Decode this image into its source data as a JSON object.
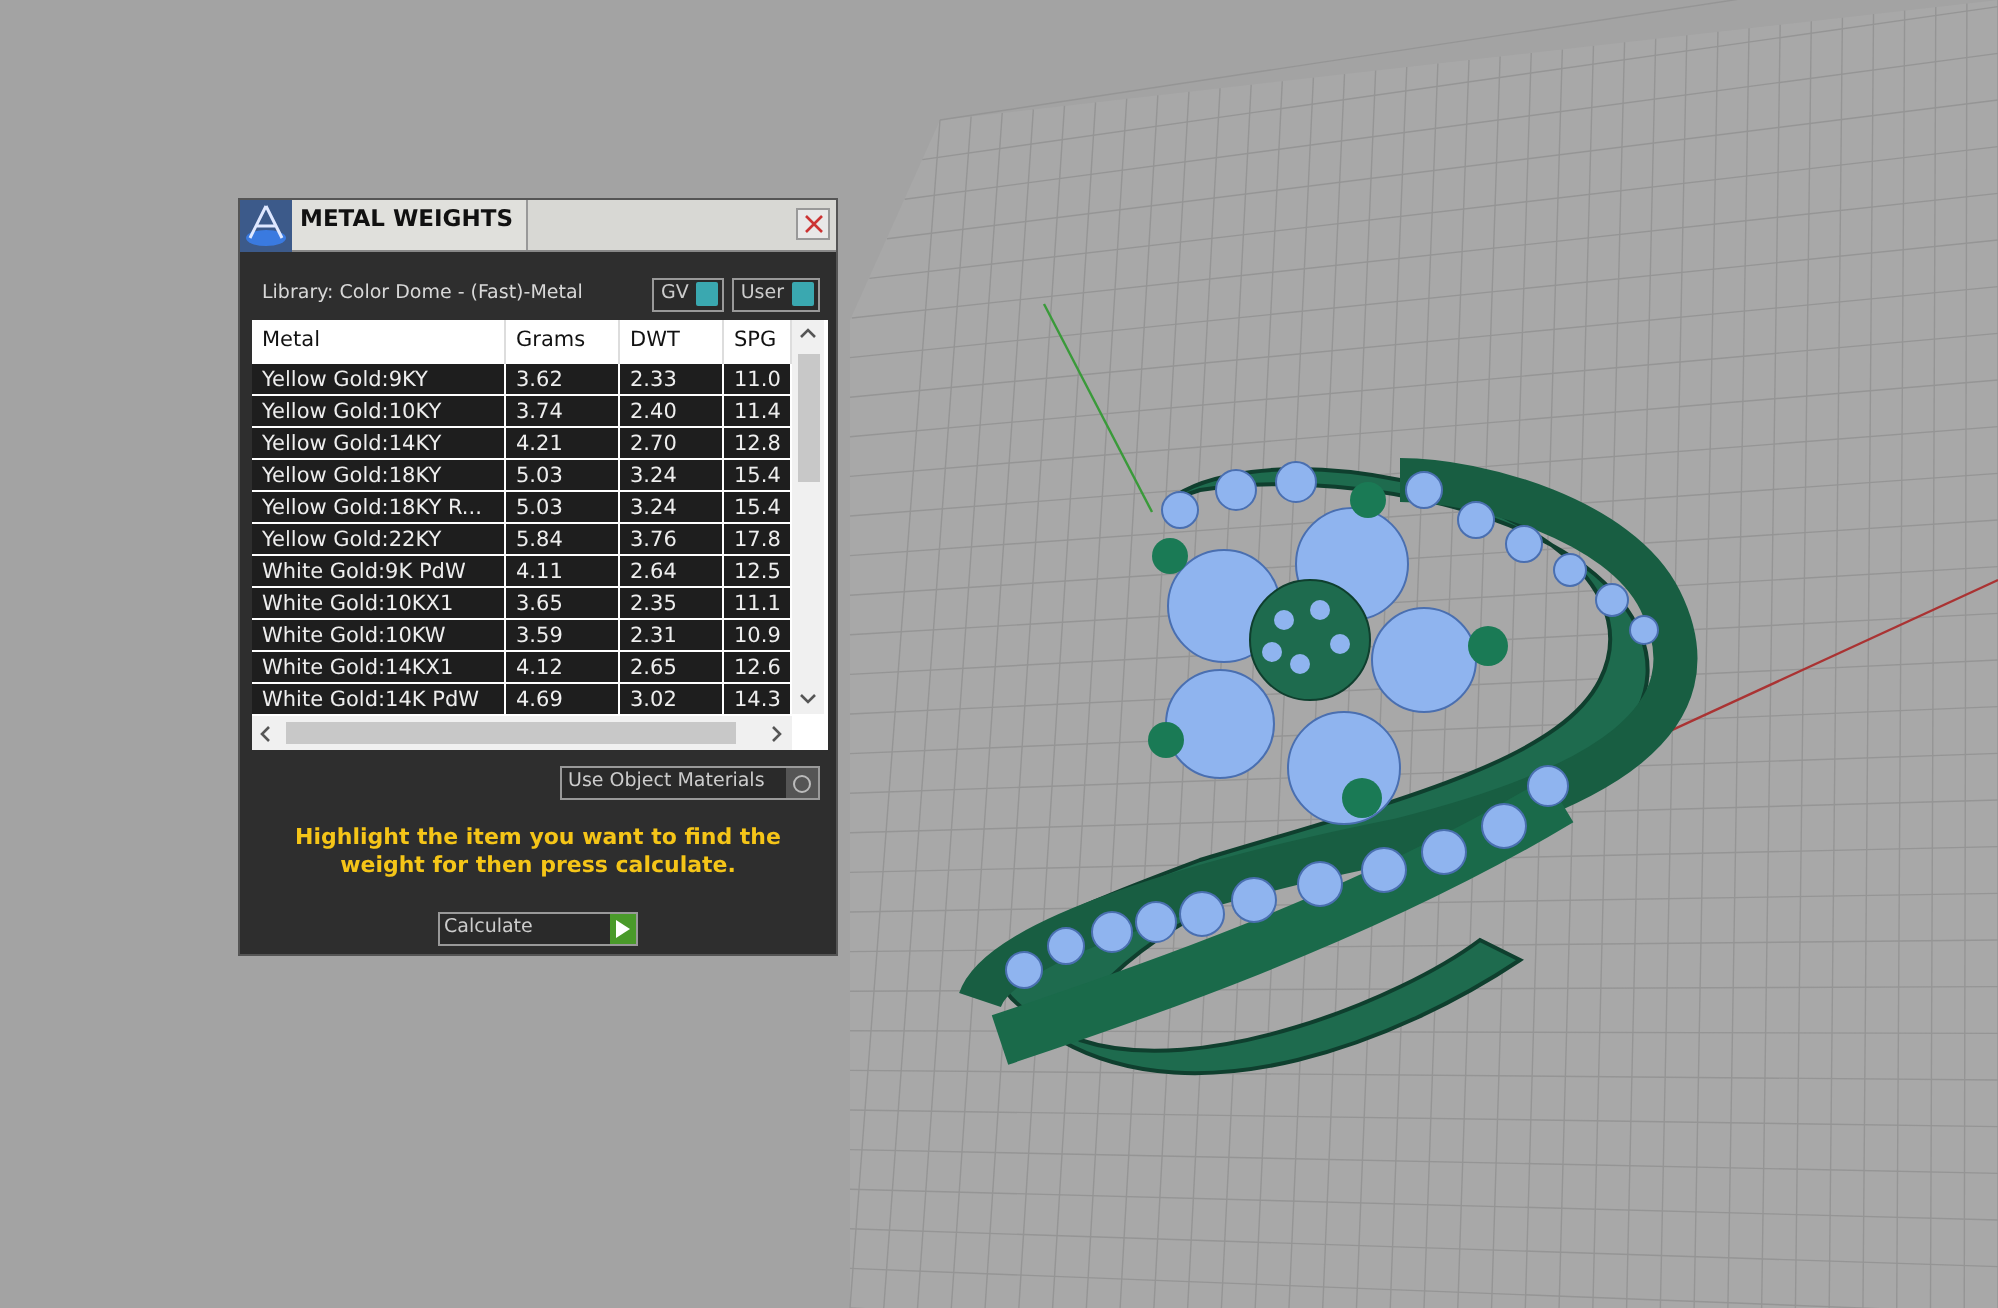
{
  "window": {
    "title": "METAL WEIGHTS"
  },
  "library_label": "Library: Color Dome - (Fast)-Metal",
  "toggles": [
    {
      "label": "GV"
    },
    {
      "label": "User"
    }
  ],
  "table": {
    "columns": [
      "Metal",
      "Grams",
      "DWT",
      "SPG"
    ],
    "rows": [
      [
        "Yellow Gold:9KY",
        "3.62",
        "2.33",
        "11.0"
      ],
      [
        "Yellow Gold:10KY",
        "3.74",
        "2.40",
        "11.4"
      ],
      [
        "Yellow Gold:14KY",
        "4.21",
        "2.70",
        "12.8"
      ],
      [
        "Yellow Gold:18KY",
        "5.03",
        "3.24",
        "15.4"
      ],
      [
        "Yellow Gold:18KY R...",
        "5.03",
        "3.24",
        "15.4"
      ],
      [
        "Yellow Gold:22KY",
        "5.84",
        "3.76",
        "17.8"
      ],
      [
        "White Gold:9K PdW",
        "4.11",
        "2.64",
        "12.5"
      ],
      [
        "White Gold:10KX1",
        "3.65",
        "2.35",
        "11.1"
      ],
      [
        "White Gold:10KW",
        "3.59",
        "2.31",
        "10.9"
      ],
      [
        "White Gold:14KX1",
        "4.12",
        "2.65",
        "12.6"
      ],
      [
        "White Gold:14K PdW",
        "4.69",
        "3.02",
        "14.3"
      ]
    ]
  },
  "use_object_materials": {
    "label": "Use Object Materials",
    "checked": false
  },
  "instruction": "Highlight the item you want to find the weight for then press calculate.",
  "calculate_button": {
    "label": "Calculate"
  }
}
